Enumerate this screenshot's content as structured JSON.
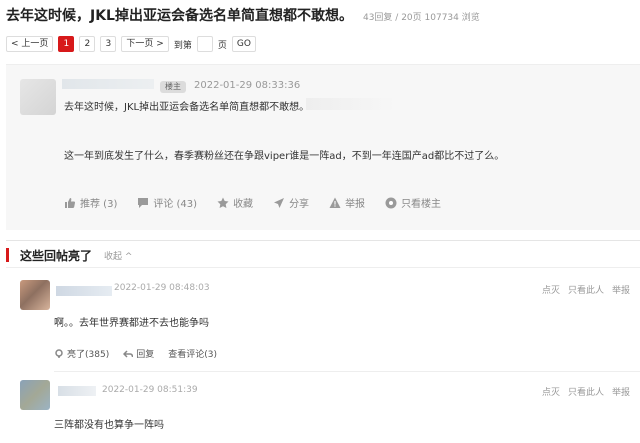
{
  "header": {
    "title": "去年这时候，JKL掉出亚运会备选名单简直想都不敢想。",
    "reply_count": "43回复",
    "page_count": "20页",
    "views": "107734 浏览",
    "separator": " / "
  },
  "pager": {
    "prev": "< 上一页",
    "pages": [
      "1",
      "2",
      "3"
    ],
    "next": "下一页 >",
    "goto_label": "到第",
    "page_unit": "页",
    "go": "GO"
  },
  "post": {
    "owner_badge": "楼主",
    "time": "2022-01-29 08:33:36",
    "line1": "去年这时候，JKL掉出亚运会备选名单简直想都不敢想。",
    "line2": "这一年到底发生了什么，春季赛粉丝还在争跟viper谁是一阵ad，不到一年连国产ad都比不过了么。",
    "actions": {
      "recommend": "推荐 (3)",
      "comment": "评论 (43)",
      "favorite": "收藏",
      "share": "分享",
      "report": "举报",
      "owner_only": "只看楼主"
    }
  },
  "hot_replies": {
    "title": "这些回帖亮了",
    "collapse": "收起 ^",
    "items": [
      {
        "time": "2022-01-29 08:48:03",
        "text": "啊。。去年世界赛都进不去也能争吗",
        "ops": [
          "点灭",
          "只看此人",
          "举报"
        ],
        "likes": "亮了(385)",
        "reply": "回复",
        "view_comments": "查看评论(3)"
      },
      {
        "time": "2022-01-29 08:51:39",
        "text": "三阵都没有也算争一阵吗",
        "ops": [
          "点灭",
          "只看此人",
          "举报"
        ]
      }
    ]
  },
  "colors": {
    "accent": "#d7191a",
    "post_bg": "#f7f7f7",
    "muted": "#999999"
  }
}
